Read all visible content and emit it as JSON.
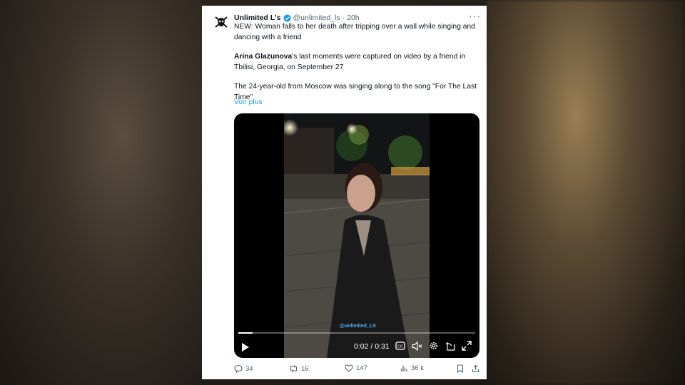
{
  "author": {
    "name": "Unlimited L's",
    "handle": "@unlimited_ls",
    "separator": "·",
    "time": "20h"
  },
  "more_label": "···",
  "paragraphs": {
    "p1": "NEW: Woman falls to her death after tripping over a wall while singing and dancing with a friend",
    "p2_bold": "Arina Glazunova",
    "p2_rest": "'s last moments were captured on video by a friend in Tbilisi, Georgia, on September 27",
    "p3": "The 24-year-old from Moscow was singing along to the song \"For The Last Time\""
  },
  "see_more": "Voir plus",
  "video": {
    "time": "0:02 / 0:31",
    "watermark": "@unlimited_LS",
    "progress_fraction": 0.06
  },
  "actions": {
    "replies": "34",
    "reposts": "16",
    "likes": "147",
    "views": "36 k"
  },
  "colors": {
    "accent": "#1d9bf0",
    "text": "#0f1419",
    "muted": "#536471"
  }
}
